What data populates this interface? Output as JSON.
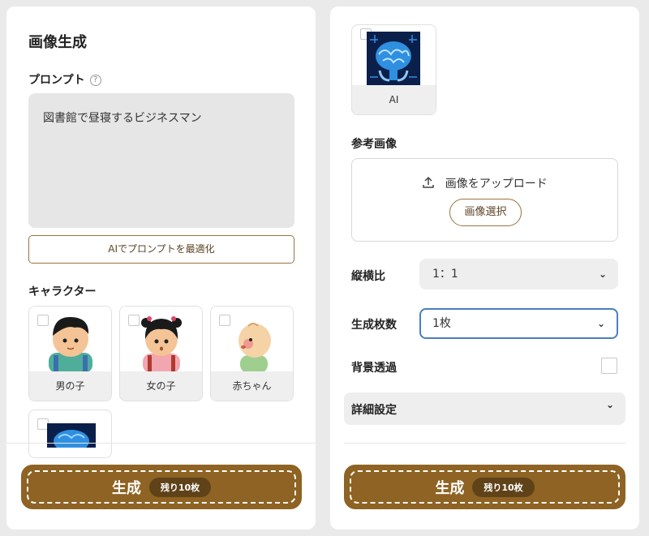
{
  "left": {
    "title": "画像生成",
    "prompt_label": "プロンプト",
    "prompt_help": "?",
    "prompt_value": "図書館で昼寝するビジネスマン",
    "optimize_label": "AIでプロンプトを最適化",
    "character_label": "キャラクター",
    "characters": [
      {
        "label": "男の子"
      },
      {
        "label": "女の子"
      },
      {
        "label": "赤ちゃん"
      }
    ],
    "generate_label": "生成",
    "remaining_label": "残り10枚"
  },
  "right": {
    "ai_card_label": "AI",
    "reference_label": "参考画像",
    "upload_text": "画像をアップロード",
    "select_image_label": "画像選択",
    "aspect_label": "縦横比",
    "aspect_value": "1：1",
    "count_label": "生成枚数",
    "count_value": "1枚",
    "transparent_label": "背景透過",
    "details_label": "詳細設定",
    "generate_label": "生成",
    "remaining_label": "残り10枚"
  },
  "colors": {
    "brand": "#8e6323",
    "brand_dark": "#5f4218",
    "focus": "#4a7fbd"
  }
}
